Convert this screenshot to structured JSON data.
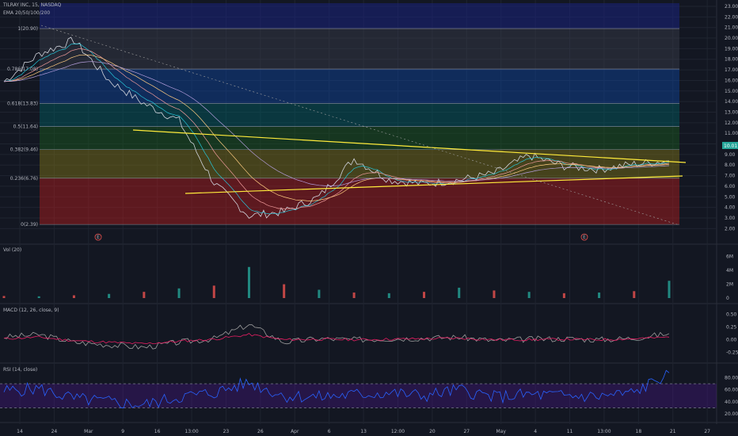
{
  "header": {
    "symbol_line": "TILRAY INC, 15, NASDAQ",
    "indicator_line": "EMA 20/50/100/200"
  },
  "colors": {
    "background": "#131722",
    "grid": "#1f2430",
    "candle_up": "#26a69a",
    "candle_down": "#ef5350",
    "trend": "#ffeb3b",
    "macd_line": "#9e9e9e",
    "macd_signal": "#e91e63",
    "rsi_line": "#2962ff",
    "rsi_band": "#4a148c",
    "vol": "#5d6b7a"
  },
  "chart_data": [
    {
      "type": "line",
      "pane": "price",
      "y_ticks": [
        "23.00",
        "22.00",
        "21.00",
        "20.00",
        "19.00",
        "18.00",
        "17.00",
        "16.00",
        "15.00",
        "14.00",
        "13.00",
        "12.00",
        "11.00",
        "10.00",
        "9.00",
        "8.00",
        "7.00",
        "6.00",
        "5.00",
        "4.00",
        "3.00",
        "2.00"
      ],
      "ylim": [
        1.5,
        23.3
      ],
      "fib_levels": [
        {
          "label": "1(20.90)",
          "value": 20.9
        },
        {
          "label": "0.786(17.08)",
          "value": 17.08
        },
        {
          "label": "0.618(13.83)",
          "value": 13.83
        },
        {
          "label": "0.5(11.64)",
          "value": 11.64
        },
        {
          "label": "0.382(9.46)",
          "value": 9.46
        },
        {
          "label": "0.236(6.76)",
          "value": 6.76
        },
        {
          "label": "0(2.39)",
          "value": 2.39
        }
      ],
      "price_marker": "10.01",
      "x_ticks": [
        "14",
        "24",
        "Mar",
        "9",
        "16",
        "13:00",
        "23",
        "26",
        "Apr",
        "6",
        "13",
        "12:00",
        "20",
        "27",
        "May",
        "4",
        "11",
        "13:00",
        "18",
        "21",
        "27"
      ],
      "x": [
        "14",
        "24",
        "Mar",
        "9",
        "16",
        "13:00",
        "23",
        "26",
        "Apr",
        "6",
        "13",
        "12:00",
        "20",
        "27",
        "May",
        "4",
        "11",
        "13:00",
        "18",
        "21"
      ],
      "series": [
        {
          "values": [
            15.9,
            18.5,
            19.8,
            16.0,
            13.8,
            12.2,
            6.3,
            3.2,
            3.6,
            5.0,
            8.6,
            6.6,
            6.2,
            6.6,
            7.2,
            8.9,
            7.9,
            7.6,
            8.1,
            8.4
          ]
        }
      ],
      "events": [
        "E",
        "E"
      ]
    },
    {
      "type": "bar",
      "pane": "volume",
      "title": "Vol (20)",
      "y_ticks": [
        "6M",
        "4M",
        "2M",
        "0"
      ],
      "ylim": [
        0,
        7000000
      ],
      "x": [
        "14",
        "24",
        "Mar",
        "9",
        "16",
        "13:00",
        "23",
        "26",
        "Apr",
        "6",
        "13",
        "12:00",
        "20",
        "27",
        "May",
        "4",
        "11",
        "13:00",
        "18",
        "21"
      ],
      "values": [
        300000,
        250000,
        400000,
        600000,
        900000,
        1400000,
        1800000,
        4500000,
        2000000,
        1200000,
        800000,
        700000,
        900000,
        1500000,
        1100000,
        900000,
        700000,
        800000,
        1000000,
        2500000
      ]
    },
    {
      "type": "line",
      "pane": "macd",
      "title": "MACD (12, 26, close, 9)",
      "y_ticks": [
        "0.50",
        "0.25",
        "0.00",
        "-0.25"
      ],
      "ylim": [
        -0.35,
        0.6
      ],
      "x": [
        "14",
        "24",
        "Mar",
        "9",
        "16",
        "13:00",
        "23",
        "26",
        "Apr",
        "6",
        "13",
        "12:00",
        "20",
        "27",
        "May",
        "4",
        "11",
        "13:00",
        "18",
        "21"
      ],
      "series": [
        {
          "values": [
            0.05,
            0.1,
            -0.05,
            -0.1,
            -0.15,
            -0.05,
            0.02,
            0.3,
            -0.05,
            0.02,
            0.0,
            0.02,
            0.03,
            0.05,
            -0.02,
            0.01,
            0.02,
            0.0,
            0.03,
            0.12
          ]
        },
        {
          "values": [
            0.02,
            0.05,
            -0.02,
            -0.05,
            -0.08,
            -0.03,
            0.01,
            0.1,
            0.0,
            0.01,
            0.0,
            0.01,
            0.02,
            0.03,
            0.0,
            0.0,
            0.01,
            0.0,
            0.02,
            0.05
          ]
        }
      ]
    },
    {
      "type": "line",
      "pane": "rsi",
      "title": "RSI (14, close)",
      "y_ticks": [
        "80.00",
        "60.00",
        "40.00",
        "20.00"
      ],
      "ylim": [
        15,
        95
      ],
      "band": [
        30,
        70
      ],
      "x": [
        "14",
        "24",
        "Mar",
        "9",
        "16",
        "13:00",
        "23",
        "26",
        "Apr",
        "6",
        "13",
        "12:00",
        "20",
        "27",
        "May",
        "4",
        "11",
        "13:00",
        "18",
        "21"
      ],
      "series": [
        {
          "values": [
            58,
            62,
            45,
            40,
            35,
            48,
            55,
            72,
            50,
            48,
            52,
            55,
            50,
            60,
            48,
            52,
            50,
            49,
            55,
            88
          ]
        }
      ]
    }
  ]
}
